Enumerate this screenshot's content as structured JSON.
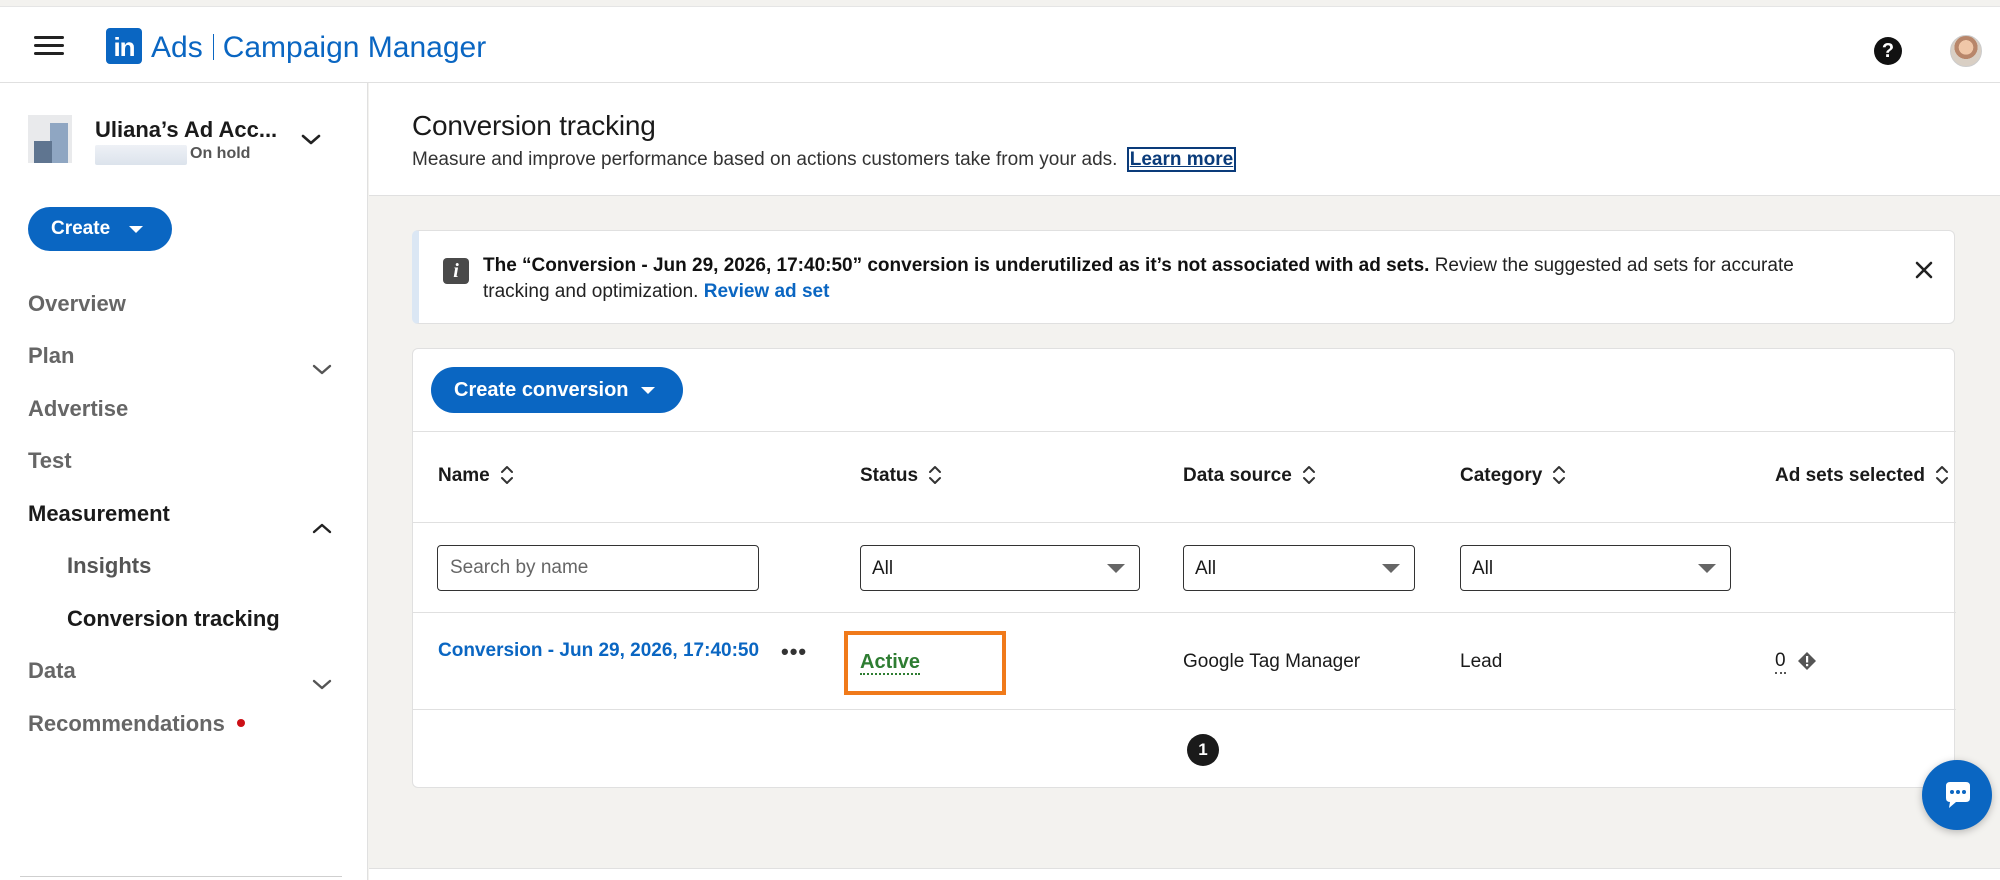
{
  "header": {
    "brand_ads": "Ads",
    "brand_product": "Campaign Manager",
    "logo_text": "in",
    "help_glyph": "?"
  },
  "account": {
    "name": "Uliana’s Ad Acc...",
    "status": "On hold"
  },
  "sidebar": {
    "create_label": "Create",
    "items": [
      {
        "label": "Overview"
      },
      {
        "label": "Plan"
      },
      {
        "label": "Advertise"
      },
      {
        "label": "Test"
      },
      {
        "label": "Measurement"
      },
      {
        "label": "Insights"
      },
      {
        "label": "Conversion tracking"
      },
      {
        "label": "Data"
      },
      {
        "label": "Recommendations"
      }
    ]
  },
  "page": {
    "title": "Conversion tracking",
    "description": "Measure and improve performance based on actions customers take from your ads.",
    "learn_more": "Learn more"
  },
  "banner": {
    "bold_text": "The “Conversion - Jun 29, 2026, 17:40:50” conversion is underutilized as it’s not associated with ad sets.",
    "text": " Review the suggested ad sets for accurate tracking and optimization. ",
    "link": "Review ad set",
    "info_glyph": "i"
  },
  "table": {
    "create_conversion_label": "Create conversion",
    "columns": [
      "Name",
      "Status",
      "Data source",
      "Category",
      "Ad sets selected"
    ],
    "search_placeholder": "Search by name",
    "filters": {
      "status": "All",
      "data_source": "All",
      "category": "All"
    },
    "rows": [
      {
        "name": "Conversion - Jun 29, 2026, 17:40:50",
        "more": "•••",
        "status": "Active",
        "data_source": "Google Tag Manager",
        "category": "Lead",
        "ad_sets_selected": "0"
      }
    ],
    "pagination": {
      "current_page": "1"
    }
  },
  "colors": {
    "brand_blue": "#0a66c2",
    "active_green": "#2e7d32",
    "highlight_orange": "#f07a1a",
    "notification_red": "#cc1016"
  }
}
